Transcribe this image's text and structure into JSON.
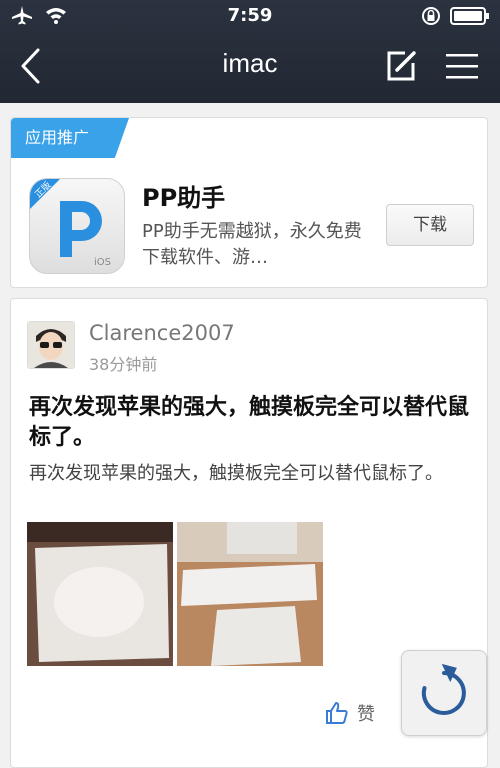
{
  "status_bar": {
    "time": "7:59"
  },
  "nav": {
    "title": "imac"
  },
  "promo": {
    "tag": "应用推广",
    "app_name": "PP助手",
    "app_desc": "PP助手无需越狱，永久免费下载软件、游…",
    "download_label": "下载",
    "icon_badge": "正版",
    "icon_os": "iOS"
  },
  "post": {
    "author": "Clarence2007",
    "time": "38分钟前",
    "title": "再次发现苹果的强大，触摸板完全可以替代鼠标了。",
    "body": "再次发现苹果的强大，触摸板完全可以替代鼠标了。",
    "like_label": "赞"
  },
  "colors": {
    "header_bg": "#252c37",
    "promo_tag": "#3aa2e8",
    "app_icon_blue": "#2b8fe0"
  }
}
